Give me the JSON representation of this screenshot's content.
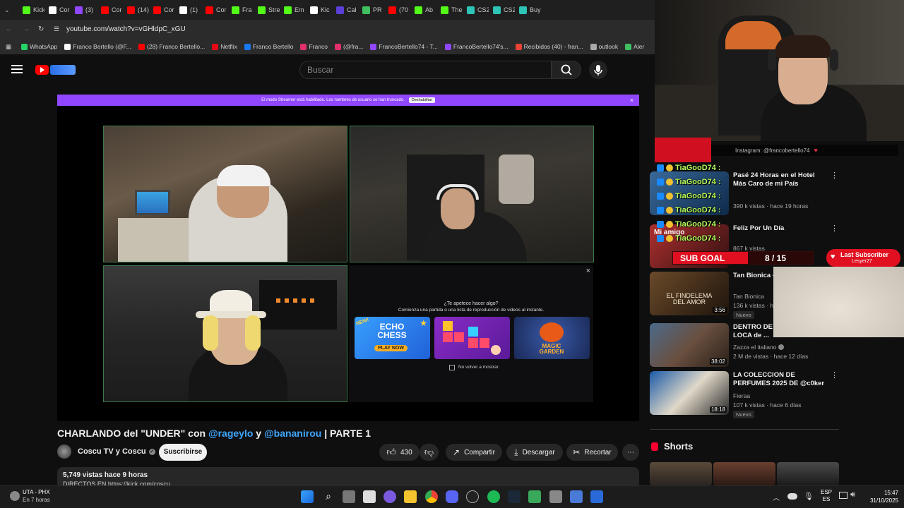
{
  "browser": {
    "tabs": [
      {
        "label": "Kick",
        "icon": "kick-icon",
        "color": "#53fc18"
      },
      {
        "label": "Cor",
        "icon": "github-icon",
        "color": "#ffffff"
      },
      {
        "label": "(3)",
        "icon": "twitch-icon",
        "color": "#9147ff"
      },
      {
        "label": "Cor",
        "icon": "youtube-icon",
        "color": "#ff0000"
      },
      {
        "label": "(14)",
        "icon": "youtube-icon",
        "color": "#ff0000"
      },
      {
        "label": "Cor",
        "icon": "youtube-icon",
        "color": "#ff0000"
      },
      {
        "label": "(1)",
        "icon": "x-icon",
        "color": "#ffffff"
      },
      {
        "label": "Cor",
        "icon": "youtube-icon",
        "color": "#ff0000"
      },
      {
        "label": "Fra",
        "icon": "kick-icon",
        "color": "#53fc18"
      },
      {
        "label": "Stre",
        "icon": "kick-icon",
        "color": "#53fc18"
      },
      {
        "label": "Em",
        "icon": "kick-icon",
        "color": "#53fc18"
      },
      {
        "label": "Kic",
        "icon": "github-icon",
        "color": "#ffffff"
      },
      {
        "label": "Cal",
        "icon": "circle-icon",
        "color": "#5b3fd6"
      },
      {
        "label": "PR",
        "icon": "shield-icon",
        "color": "#3fbf5f"
      },
      {
        "label": "(70",
        "icon": "youtube-icon",
        "color": "#ff0000"
      },
      {
        "label": "Ab",
        "icon": "kick-icon",
        "color": "#53fc18"
      },
      {
        "label": "The",
        "icon": "kick-icon",
        "color": "#53fc18"
      },
      {
        "label": "CS2",
        "icon": "cs-icon",
        "color": "#2ec4b6"
      },
      {
        "label": "CS2",
        "icon": "cs-icon",
        "color": "#2ec4b6"
      },
      {
        "label": "Buy",
        "icon": "cs-icon",
        "color": "#2ec4b6"
      }
    ],
    "url": "youtube.com/watch?v=vGHldpC_xGU",
    "bookmarks": [
      {
        "label": "WhatsApp",
        "color": "#25d366"
      },
      {
        "label": "Franco Bertello (@F...",
        "color": "#ffffff"
      },
      {
        "label": "(28) Franco Bertello...",
        "color": "#ff0000"
      },
      {
        "label": "Netflix",
        "color": "#e50914"
      },
      {
        "label": "Franco Bertello",
        "color": "#1877f2"
      },
      {
        "label": "Franco",
        "color": "#e1306c"
      },
      {
        "label": "(@fra...",
        "color": "#e1306c"
      },
      {
        "label": "FrancoBertello74 - T...",
        "color": "#9147ff"
      },
      {
        "label": "FrancoBertello74's...",
        "color": "#9147ff"
      },
      {
        "label": "Recibidos (40) - fran...",
        "color": "#ea4335"
      },
      {
        "label": "outlook",
        "color": "#aaaaaa"
      },
      {
        "label": "Aler",
        "color": "#3fbf5f"
      }
    ]
  },
  "youtube": {
    "search_placeholder": "Buscar",
    "streamer_notice": "El modo Streamer está habilitado. Los nombres de usuario se han truncado.",
    "streamer_btn": "Deshabilitar",
    "game_prompt_title": "¿Te apetece hacer algo?",
    "game_prompt_sub": "Comienza una partida o una lista de reproducción de videos al instante.",
    "game_echo": "ECHO CHESS",
    "game_echo_new": "NEW!",
    "game_echo_play": "PLAY NOW",
    "game_magic": "MAGIC GARDEN",
    "dont_show": "No volver a mostrar.",
    "title_parts": {
      "a": "CHARLANDO del \"UNDER\" con ",
      "b": "@rageylo",
      "c": " y ",
      "d": "@bananirou",
      "e": " | PARTE 1"
    },
    "channel": "Coscu TV y Coscu",
    "subscribe": "Suscribirse",
    "likes": "430",
    "share": "Compartir",
    "download": "Descargar",
    "clip": "Recortar",
    "views": "5,749 vistas  hace 9 horas",
    "desc_line": "DIRECTOS EN https://kick.com/coscu"
  },
  "sidebar": {
    "recs": [
      {
        "title": "Pasé 24 Horas en el Hotel Más Caro de mi País",
        "channel": "",
        "meta": "390 k vistas · hace 19 horas",
        "duration": "",
        "nuevo": ""
      },
      {
        "title": "Feliz Por Un Día",
        "channel": "",
        "meta": "867 k vistas",
        "duration": "",
        "nuevo": "",
        "thumb_text": "Mi amigo"
      },
      {
        "title": "Tan Bionica - Amor (Video",
        "channel": "Tan Bionica",
        "meta": "136 k vistas · hace",
        "duration": "3:56",
        "nuevo": "Nuevo",
        "thumb_text": "EL FINDELEMA DEL AMOR"
      },
      {
        "title": "DENTRO DE LA VILLA MÁS LOCA de ...",
        "channel": "Zazza el italiano",
        "meta": "2 M de vistas · hace 12 días",
        "duration": "38:02",
        "nuevo": ""
      },
      {
        "title": "LA COLECCION DE PERFUMES 2025 DE @c0ker",
        "channel": "Fieraa",
        "meta": "107 k vistas · hace 6 días",
        "duration": "18:18",
        "nuevo": "Nuevo"
      }
    ],
    "shorts_label": "Shorts"
  },
  "overlay": {
    "instagram": "Instagram: @francobertello74",
    "chat_user": "TiaGooD74 :",
    "sub_goal_label": "SUB GOAL",
    "sub_goal_value": "8 / 15",
    "sub_goal_current": 8,
    "sub_goal_target": 15,
    "last_sub_label": "Last Subscriber",
    "last_sub_name": "Lesyer27"
  },
  "taskbar": {
    "weather_title": "UTA - PHX",
    "weather_sub": "En 7 horas",
    "lang_top": "ESP",
    "lang_bottom": "ES",
    "time": "15:47",
    "date": "31/10/2025"
  }
}
